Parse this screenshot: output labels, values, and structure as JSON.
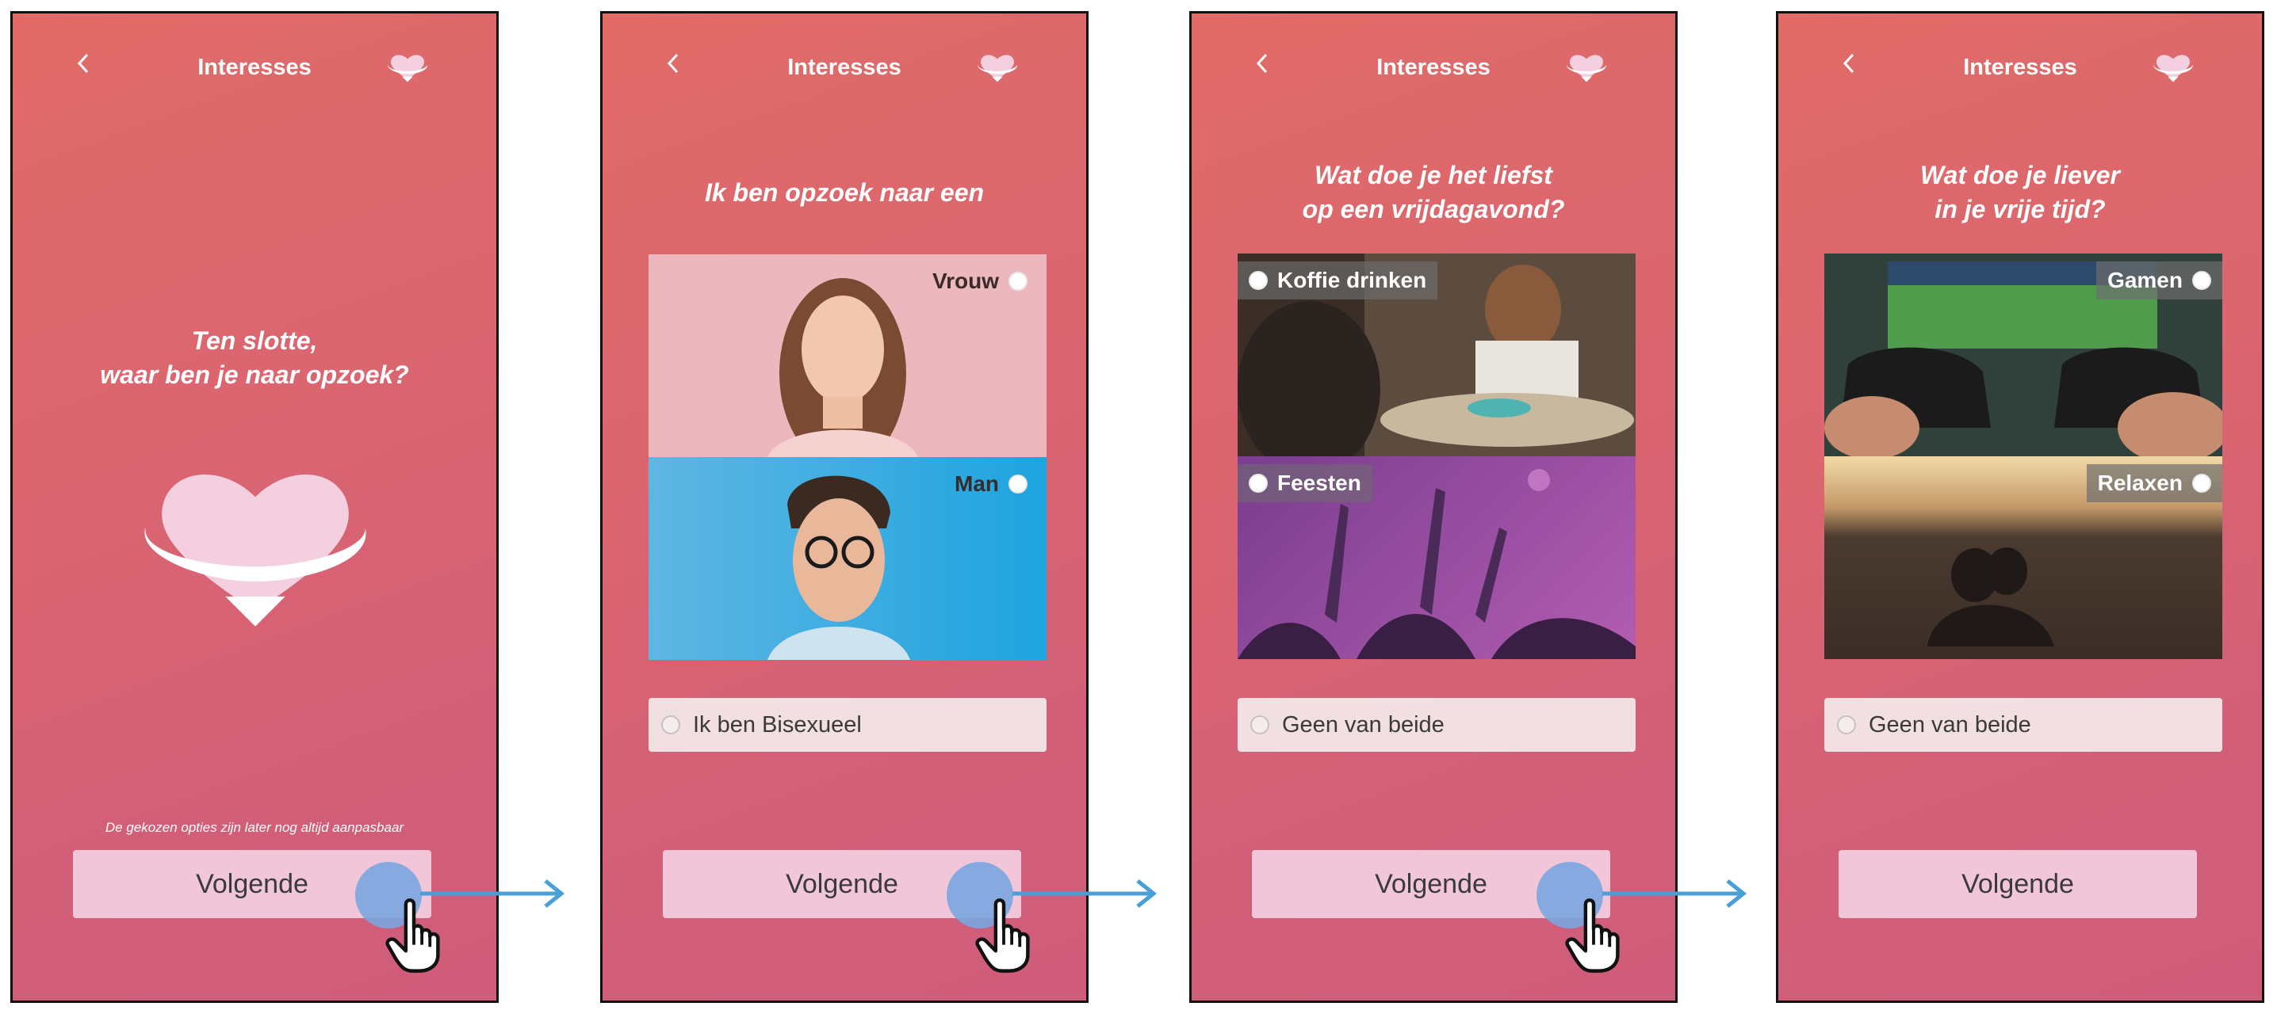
{
  "colors": {
    "bg_top": "#e06b67",
    "bg_bottom": "#cf5c7b",
    "button": "#f1c6d9",
    "arrow": "#4a9fd6",
    "tap": "#7aa6e0"
  },
  "screens": [
    {
      "back_icon": "chevron-left",
      "title": "Interesses",
      "question": [
        "Ten slotte,",
        "waar ben je naar opzoek?"
      ],
      "note": "De gekozen opties zijn later nog altijd aanpasbaar",
      "next_button": "Volgende"
    },
    {
      "back_icon": "chevron-left",
      "title": "Interesses",
      "question": [
        "Ik ben opzoek naar een"
      ],
      "options": [
        {
          "label": "Vrouw",
          "image": "woman-portrait"
        },
        {
          "label": "Man",
          "image": "man-portrait"
        }
      ],
      "extra_option": "Ik ben Bisexueel",
      "next_button": "Volgende"
    },
    {
      "back_icon": "chevron-left",
      "title": "Interesses",
      "question": [
        "Wat doe je het liefst",
        "op een vrijdagavond?"
      ],
      "options": [
        {
          "label": "Koffie drinken",
          "image": "coffee-photo"
        },
        {
          "label": "Feesten",
          "image": "party-photo"
        }
      ],
      "extra_option": "Geen van beide",
      "next_button": "Volgende"
    },
    {
      "back_icon": "chevron-left",
      "title": "Interesses",
      "question": [
        "Wat doe je liever",
        "in je vrije tijd?"
      ],
      "options": [
        {
          "label": "Gamen",
          "image": "gaming-photo"
        },
        {
          "label": "Relaxen",
          "image": "beach-photo"
        }
      ],
      "extra_option": "Geen van beide",
      "next_button": "Volgende"
    }
  ]
}
